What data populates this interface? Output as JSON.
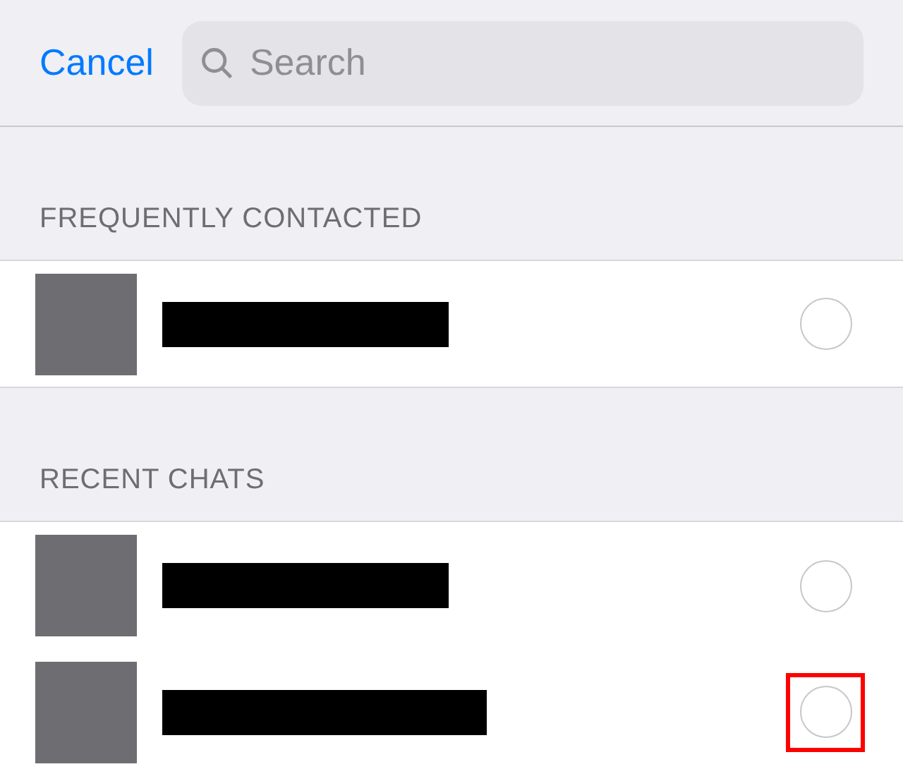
{
  "top_bar": {
    "cancel": "Cancel",
    "search": {
      "placeholder": "Search"
    }
  },
  "sections": [
    {
      "title": "FREQUENTLY CONTACTED",
      "rows": [
        {
          "selected": false,
          "highlighted": false
        }
      ]
    },
    {
      "title": "RECENT CHATS",
      "rows": [
        {
          "selected": false,
          "highlighted": false
        },
        {
          "selected": false,
          "highlighted": true
        }
      ]
    }
  ]
}
